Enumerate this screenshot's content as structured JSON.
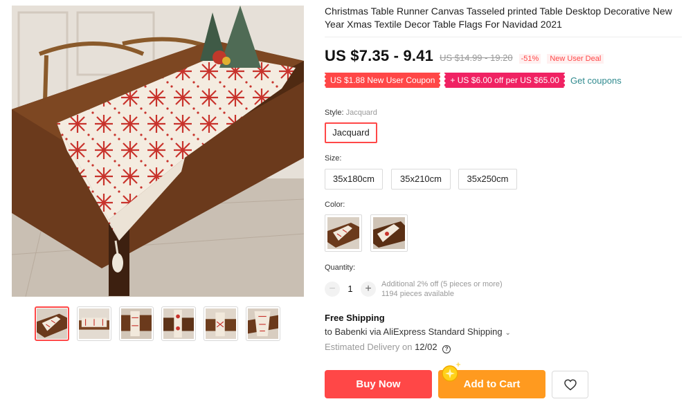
{
  "product": {
    "title": "Christmas Table Runner Canvas Tasseled printed Table Desktop Decorative New Year Xmas Textile Decor Table Flags For Navidad 2021"
  },
  "gallery": {
    "thumbnail_count": 6,
    "active_index": 0
  },
  "price": {
    "current": "US $7.35 - 9.41",
    "original": "US $14.99 - 19.20",
    "discount": "-51%",
    "deal_badge": "New User Deal"
  },
  "coupons": {
    "new_user_coupon": "US $1.88 New User Coupon",
    "store_coupon": "+ US $6.00 off per US $65.00",
    "get_coupons_link": "Get coupons"
  },
  "style": {
    "label": "Style:",
    "selected_value": "Jacquard",
    "options": [
      "Jacquard"
    ]
  },
  "size": {
    "label": "Size:",
    "options": [
      "35x180cm",
      "35x210cm",
      "35x250cm"
    ]
  },
  "color": {
    "label": "Color:",
    "option_count": 2
  },
  "quantity": {
    "label": "Quantity:",
    "minus": "−",
    "plus": "+",
    "value": "1",
    "discount_note": "Additional 2% off (5 pieces or more)",
    "available": "1194 pieces available"
  },
  "shipping": {
    "title": "Free Shipping",
    "method": "to Babenki via AliExpress Standard Shipping",
    "chevron": "⌄",
    "delivery_label": "Estimated Delivery on",
    "delivery_date": "12/02",
    "help": "?"
  },
  "actions": {
    "buy_now": "Buy Now",
    "add_to_cart": "Add to Cart"
  },
  "colors": {
    "accent_red": "#ff4747",
    "coupon_pink": "#f02263",
    "cart_orange": "#ff9a1f",
    "link_teal": "#2f8a8e"
  }
}
